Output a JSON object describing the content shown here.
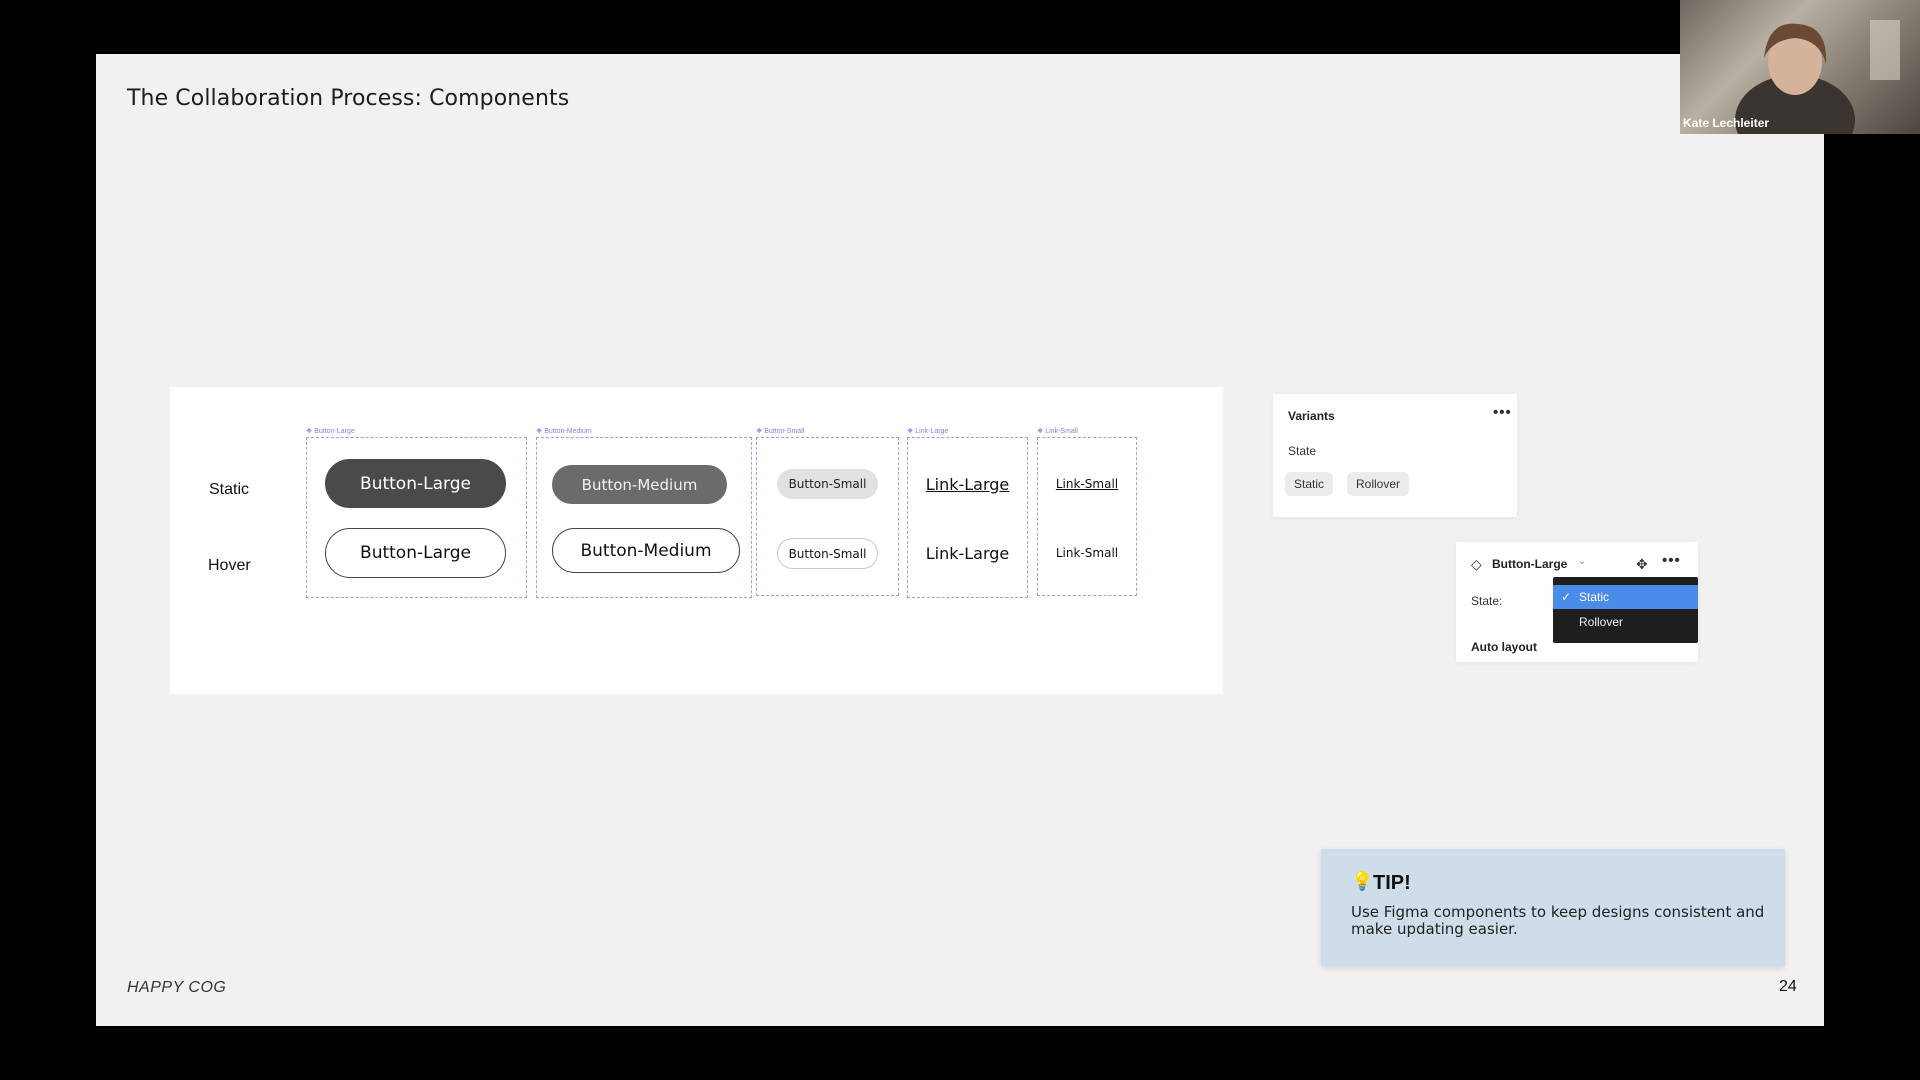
{
  "slide": {
    "title": "The Collaboration Process: Components",
    "brand": "HAPPY COG",
    "page_number": "24"
  },
  "canvas": {
    "row_labels": {
      "static": "Static",
      "hover": "Hover"
    },
    "frame_tags": {
      "button_large": "Button-Large",
      "button_medium": "Button-Medium",
      "button_small": "Button-Small",
      "link_large": "Link-Large",
      "link_small": "Link-Small"
    },
    "buttons": {
      "large_static": "Button-Large",
      "large_hover": "Button-Large",
      "medium_static": "Button-Medium",
      "medium_hover": "Button-Medium",
      "small_static": "Button-Small",
      "small_hover": "Button-Small",
      "link_large_static": "Link-Large",
      "link_large_hover": "Link-Large",
      "link_small_static": "Link-Small",
      "link_small_hover": "Link-Small"
    }
  },
  "variants_panel": {
    "heading": "Variants",
    "property_label": "State",
    "chips": [
      "Static",
      "Rollover"
    ]
  },
  "props_panel": {
    "component_name": "Button-Large",
    "state_label": "State:",
    "dropdown_options": [
      "Static",
      "Rollover"
    ],
    "selected_option": "Static",
    "auto_layout_label": "Auto layout"
  },
  "tip": {
    "title": "TIP!",
    "text": "Use Figma components to keep designs consistent and make updating easier."
  },
  "video": {
    "participant_name": "Kate Lechleiter"
  }
}
